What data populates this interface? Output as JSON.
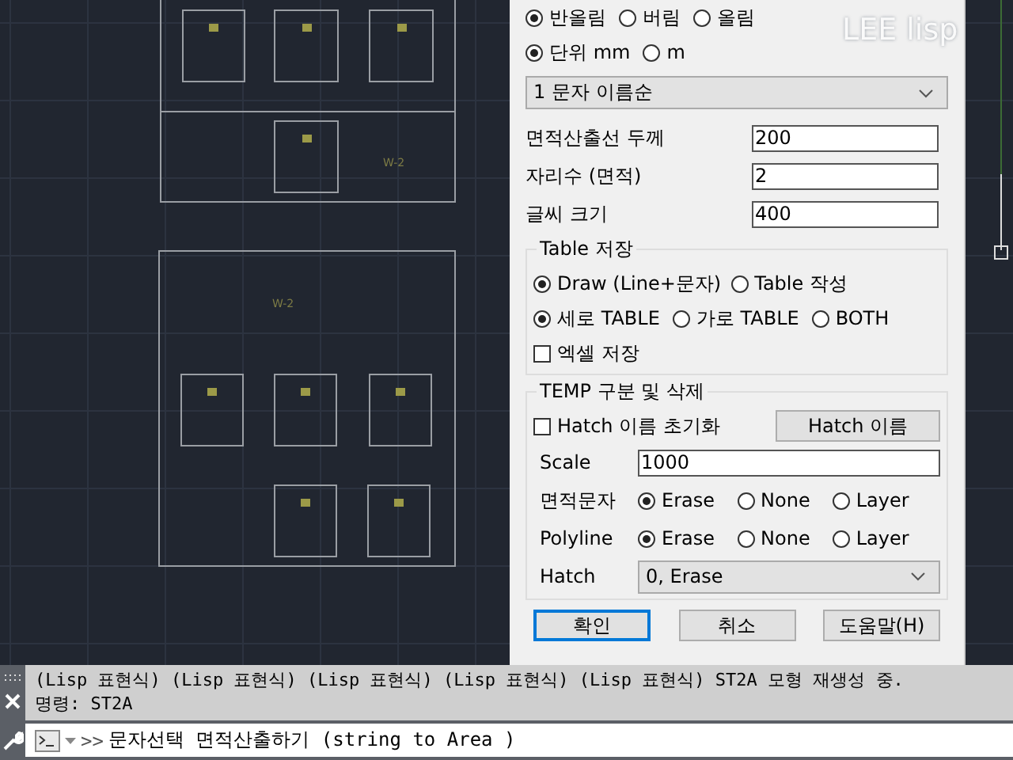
{
  "drawing": {
    "labels": [
      "W-2",
      "W-2"
    ],
    "overlay_text": "LEE lisp"
  },
  "dialog": {
    "rounding": [
      {
        "label": "반올림",
        "selected": true
      },
      {
        "label": "버림",
        "selected": false
      },
      {
        "label": "올림",
        "selected": false
      }
    ],
    "unit": [
      {
        "label": "단위 mm",
        "selected": true
      },
      {
        "label": "m",
        "selected": false
      }
    ],
    "sort_dropdown": "1 문자 이름순",
    "fields": [
      {
        "label": "면적산출선 두께",
        "value": "200"
      },
      {
        "label": "자리수 (면적)",
        "value": "2"
      },
      {
        "label": "글씨 크기",
        "value": "400"
      }
    ],
    "table_group": {
      "title": "Table 저장",
      "output": [
        {
          "label": "Draw (Line+문자)",
          "selected": true
        },
        {
          "label": "Table 작성",
          "selected": false
        }
      ],
      "orientation": [
        {
          "label": "세로 TABLE",
          "selected": true
        },
        {
          "label": "가로 TABLE",
          "selected": false
        },
        {
          "label": "BOTH",
          "selected": false
        }
      ],
      "excel": {
        "label": "엑셀 저장",
        "checked": false
      }
    },
    "temp_group": {
      "title": "TEMP 구분 및 삭제",
      "hatch_reset": {
        "label": "Hatch 이름 초기화",
        "checked": false
      },
      "hatch_name_button": "Hatch 이름",
      "scale": {
        "label": "Scale",
        "value": "1000"
      },
      "radio_rows": [
        {
          "label": "면적문자",
          "options": [
            {
              "label": "Erase",
              "selected": true
            },
            {
              "label": "None",
              "selected": false
            },
            {
              "label": "Layer",
              "selected": false
            }
          ]
        },
        {
          "label": "Polyline",
          "options": [
            {
              "label": "Erase",
              "selected": true
            },
            {
              "label": "None",
              "selected": false
            },
            {
              "label": "Layer",
              "selected": false
            }
          ]
        }
      ],
      "hatch": {
        "label": "Hatch",
        "value": "0, Erase"
      }
    },
    "buttons": [
      {
        "label": "확인",
        "default": true
      },
      {
        "label": "취소",
        "default": false
      },
      {
        "label": "도움말(H)",
        "default": false
      }
    ]
  },
  "command_line": {
    "history": [
      "(Lisp 표현식) (Lisp 표현식) (Lisp 표현식) (Lisp 표현식) (Lisp 표현식) ST2A 모형 재생성 중.",
      "명령: ST2A"
    ],
    "prompt_marker": ">>",
    "prompt": "문자선택 면적산출하기 (string to Area )"
  }
}
